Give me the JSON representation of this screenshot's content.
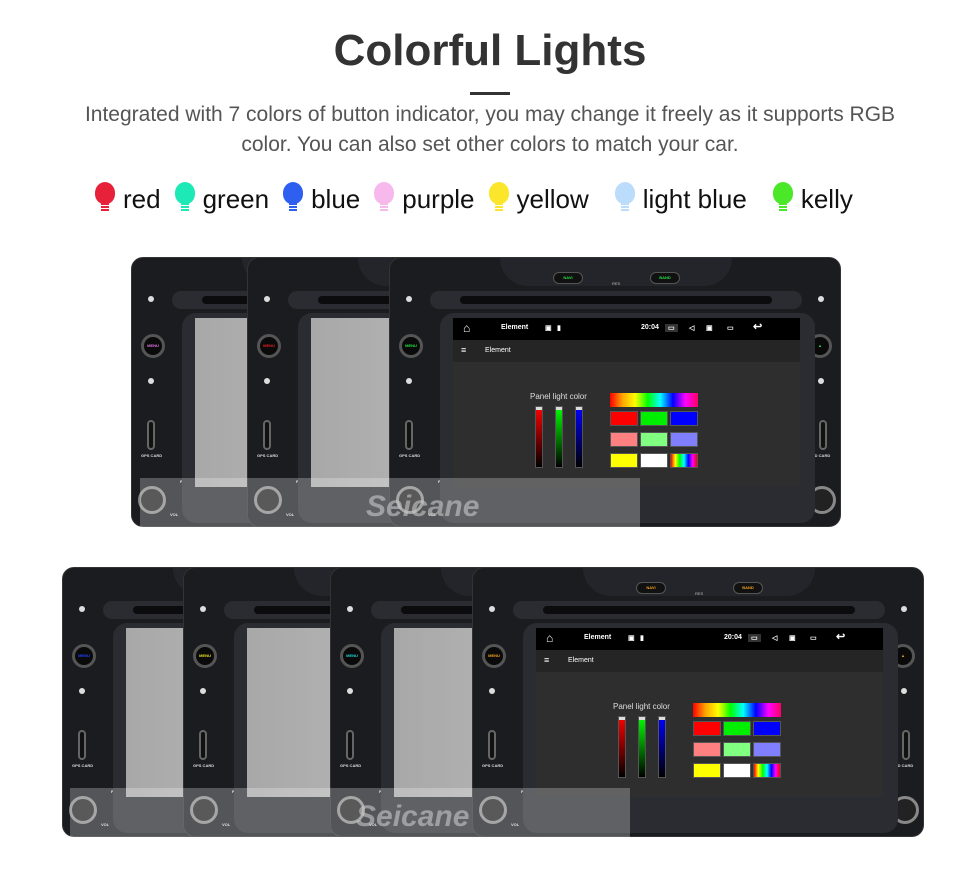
{
  "title": "Colorful Lights",
  "subtitle": "Integrated with 7 colors of button indicator, you may change it freely as it supports RGB color. You can also set other colors to match your car.",
  "legend": [
    {
      "label": "red",
      "color": "#e8213a"
    },
    {
      "label": "green",
      "color": "#1de9b6"
    },
    {
      "label": "blue",
      "color": "#2f5ff0"
    },
    {
      "label": "purple",
      "color": "#f7b9ec"
    },
    {
      "label": "yellow",
      "color": "#fbe62c"
    },
    {
      "label": "light blue",
      "color": "#bcdcfb"
    },
    {
      "label": "kelly",
      "color": "#4be82a"
    }
  ],
  "device_labels": {
    "navi": "NAVI",
    "res": "RES",
    "band": "BAND",
    "menu": "MENU",
    "gps": "GPS CARD",
    "sd": "SD CARD",
    "pwr": "PWR",
    "vol": "VOL",
    "mute": "MUTE",
    "tune": "TUNE"
  },
  "screen": {
    "app": "Element",
    "time": "20:04",
    "header": "Element",
    "panel_label": "Panel light color",
    "swatches": [
      "#ff0000",
      "#00ee00",
      "#0000ff",
      "#ff8080",
      "#80ff80",
      "#8080ff",
      "#ffff00",
      "#ffffff",
      "rainbow"
    ]
  },
  "watermark": "Seicane",
  "rows": [
    {
      "menu_colors": [
        "#e070e0",
        "#e02020",
        "#20e040"
      ]
    },
    {
      "menu_colors": [
        "#2040ff",
        "#e8e020",
        "#20d8d8",
        "#f0a020"
      ]
    }
  ]
}
